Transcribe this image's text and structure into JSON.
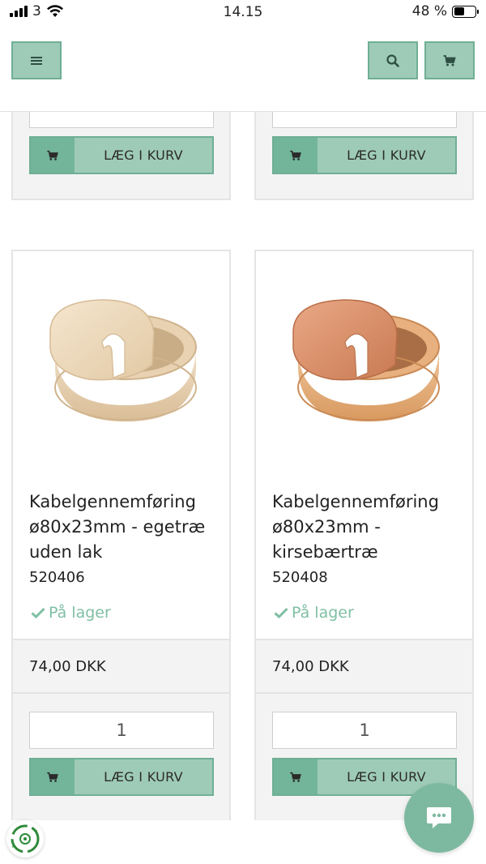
{
  "status": {
    "carrier": "3",
    "time": "14.15",
    "battery": "48 %",
    "battery_level": 0.48
  },
  "header": {
    "menu_icon": "hamburger-icon",
    "search_icon": "search-icon",
    "cart_icon": "cart-icon"
  },
  "top_cards": [
    {
      "add_label": "LÆG I KURV"
    },
    {
      "add_label": "LÆG I KURV"
    }
  ],
  "products": [
    {
      "title": "Kabelgennemføring ø80x23mm - egetræ uden lak",
      "sku": "520406",
      "stock": "På lager",
      "price": "74,00 DKK",
      "qty": "1",
      "add_label": "LÆG I KURV",
      "wood_color": "#e8d2b2"
    },
    {
      "title": "Kabelgennemføring ø80x23mm - kirsebærtræ",
      "sku": "520408",
      "stock": "På lager",
      "price": "74,00 DKK",
      "qty": "1",
      "add_label": "LÆG I KURV",
      "wood_color": "#d9966a"
    }
  ],
  "colors": {
    "accent": "#9ecbb7",
    "accent_dark": "#73b59a",
    "stock_green": "#7fbfa3"
  }
}
